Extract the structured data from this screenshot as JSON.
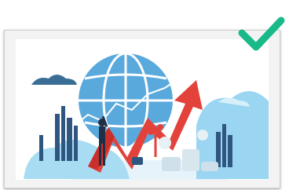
{
  "image": {
    "subject": "global-economic-growth-illustration"
  },
  "badge": {
    "icon": "checkmark-icon",
    "color": "#1ab98a"
  },
  "colors": {
    "globe": "#5aa9dc",
    "globe_lines": "#ffffff",
    "arrow": "#e3423a",
    "cloud": "#8ad1f0",
    "city": "#2e5680",
    "coins": "#d8e6ee",
    "person": "#1f2f46"
  }
}
